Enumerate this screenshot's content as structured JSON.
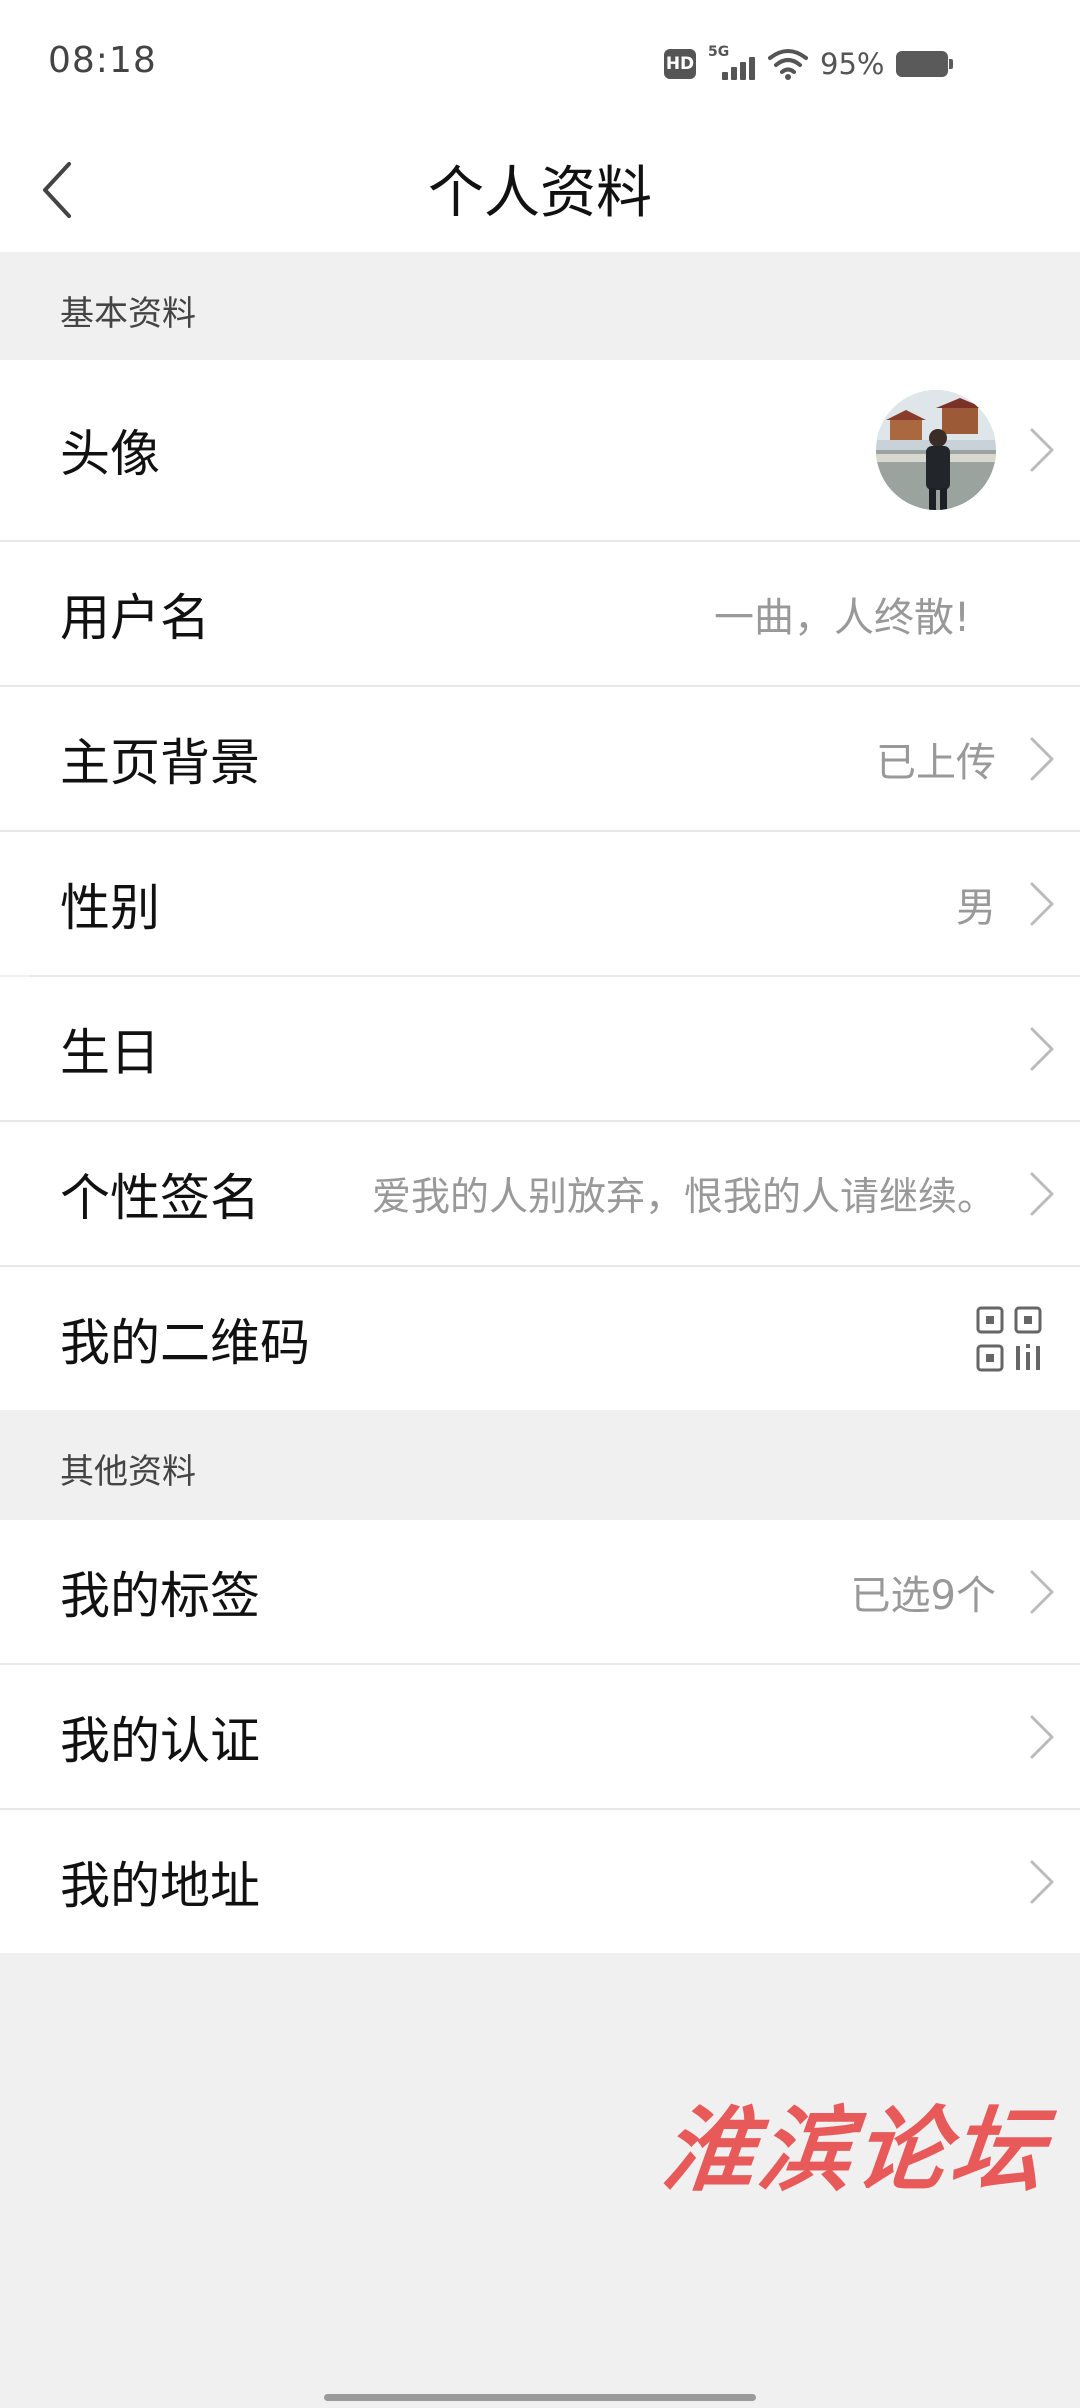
{
  "status_bar": {
    "time": "08:18",
    "hd_badge": "HD",
    "network": "5G",
    "battery_percent": "95%"
  },
  "header": {
    "title": "个人资料"
  },
  "sections": {
    "basic": "基本资料",
    "other": "其他资料"
  },
  "rows": {
    "avatar": {
      "label": "头像"
    },
    "username": {
      "label": "用户名",
      "value": "一曲，人终散!"
    },
    "background": {
      "label": "主页背景",
      "value": "已上传"
    },
    "gender": {
      "label": "性别",
      "value": "男"
    },
    "birthday": {
      "label": "生日"
    },
    "signature": {
      "label": "个性签名",
      "value": "爱我的人别放弃，恨我的人请继续。"
    },
    "qrcode": {
      "label": "我的二维码"
    },
    "tags": {
      "label": "我的标签",
      "value": "已选9个"
    },
    "certification": {
      "label": "我的认证"
    },
    "address": {
      "label": "我的地址"
    }
  },
  "watermark": "淮滨论坛",
  "colors": {
    "background": "#f0f0f0",
    "row_background": "#ffffff",
    "secondary_text": "#999999",
    "watermark": "#e85a5a"
  },
  "icons": [
    "hd-icon",
    "cellular-signal-icon",
    "wifi-icon",
    "battery-icon",
    "back-arrow-icon",
    "chevron-right-icon",
    "qr-code-icon"
  ]
}
